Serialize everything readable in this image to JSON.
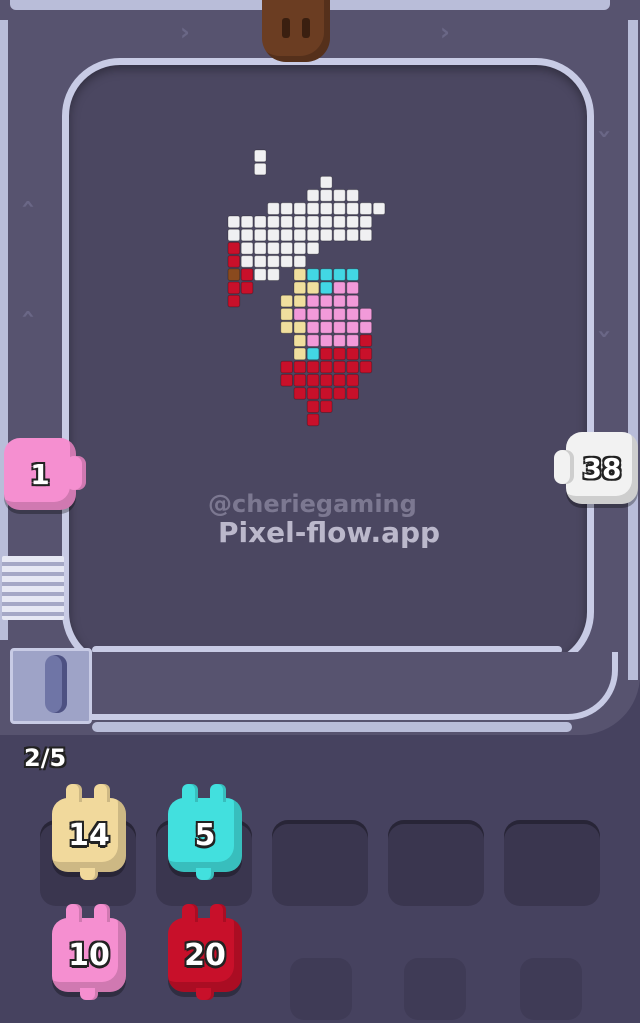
{
  "watermark": {
    "handle": "@cheriegaming",
    "site": "Pixel-flow.app"
  },
  "top_shooter": {
    "color": "#6b3d22",
    "icon": "brown-character-icon"
  },
  "left_shooter": {
    "count": "1",
    "color": "#f58fd0"
  },
  "right_shooter": {
    "count": "38",
    "color": "#f2f2f2"
  },
  "queue": {
    "counter": "2/5"
  },
  "units": [
    {
      "count": "14",
      "color": "#f1d99c"
    },
    {
      "count": "5",
      "color": "#42e0de"
    },
    {
      "count": "10",
      "color": "#f58fd0"
    },
    {
      "count": "20",
      "color": "#c8102a"
    }
  ],
  "colors": {
    "white": "#f0f0f2",
    "red": "#c8102a",
    "cyan": "#42d7e4",
    "pink": "#f29ad9",
    "cream": "#f0df9e",
    "brown": "#8a4a1e"
  }
}
